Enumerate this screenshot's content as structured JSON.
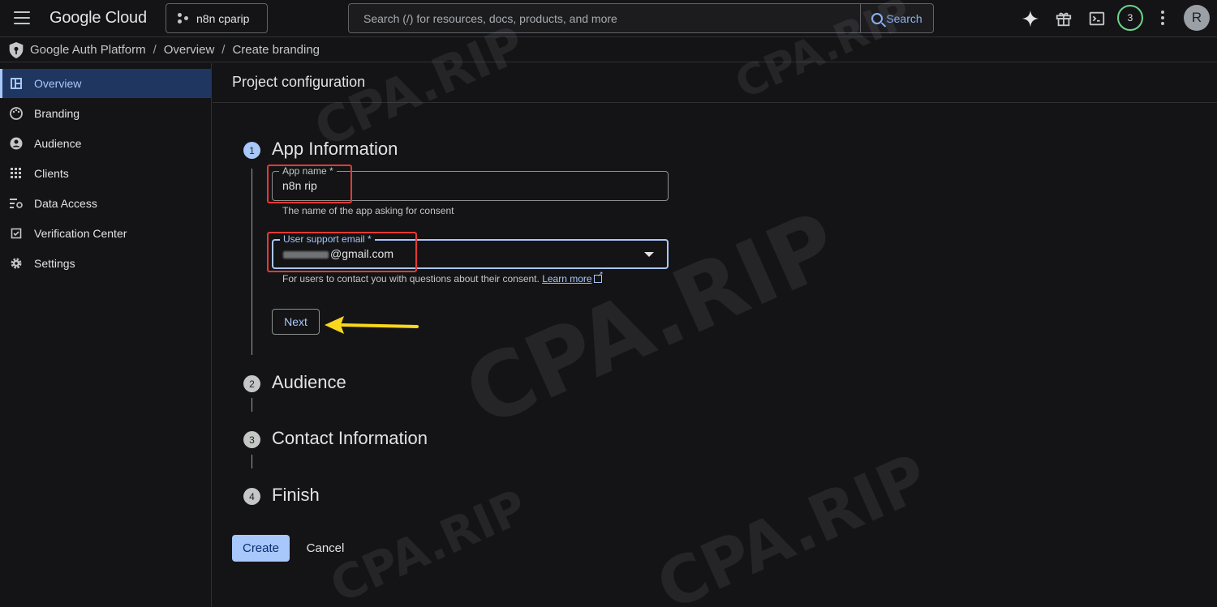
{
  "topbar": {
    "logo": "Google Cloud",
    "project": "n8n cparip",
    "search_placeholder": "Search (/) for resources, docs, products, and more",
    "search_button": "Search",
    "notifications_count": "3",
    "avatar_initial": "R"
  },
  "breadcrumb": {
    "items": [
      "Google Auth Platform",
      "Overview",
      "Create branding"
    ],
    "separator": "/"
  },
  "sidebar": {
    "items": [
      {
        "label": "Overview",
        "icon": "dashboard-icon",
        "active": true
      },
      {
        "label": "Branding",
        "icon": "palette-icon"
      },
      {
        "label": "Audience",
        "icon": "person-icon"
      },
      {
        "label": "Clients",
        "icon": "grid-icon"
      },
      {
        "label": "Data Access",
        "icon": "data-access-icon"
      },
      {
        "label": "Verification Center",
        "icon": "checkbox-icon"
      },
      {
        "label": "Settings",
        "icon": "gear-icon"
      }
    ]
  },
  "main": {
    "title": "Project configuration",
    "steps": [
      {
        "number": "1",
        "title": "App Information"
      },
      {
        "number": "2",
        "title": "Audience"
      },
      {
        "number": "3",
        "title": "Contact Information"
      },
      {
        "number": "4",
        "title": "Finish"
      }
    ],
    "app_name": {
      "label": "App name *",
      "value": "n8n rip",
      "hint": "The name of the app asking for consent"
    },
    "support_email": {
      "label": "User support email *",
      "value": "@gmail.com",
      "hint": "For users to contact you with questions about their consent.",
      "learn_more": "Learn more"
    },
    "next_button": "Next",
    "create_button": "Create",
    "cancel_button": "Cancel"
  },
  "watermark": "CPA.RIP",
  "colors": {
    "accent": "#a8c7fa",
    "background": "#141416",
    "highlight_box": "#e53935",
    "arrow": "#f9d71c"
  }
}
